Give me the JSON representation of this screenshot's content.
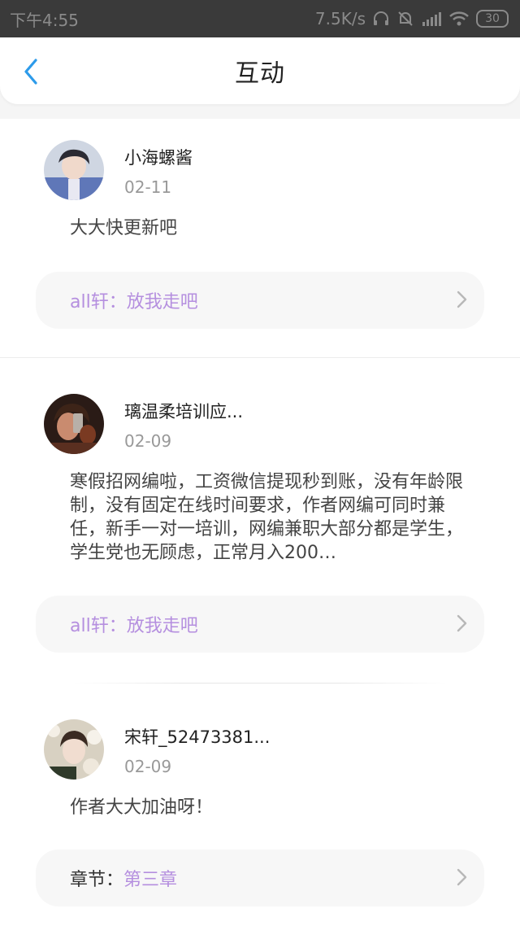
{
  "status_bar": {
    "time": "下午4:55",
    "net_speed": "7.5K/s",
    "battery": "30"
  },
  "header": {
    "title": "互动"
  },
  "items": [
    {
      "username": "小海螺酱",
      "date": "02-11",
      "comment": "大大快更新吧",
      "ref_prefix": "all轩：",
      "ref_target": "放我走吧"
    },
    {
      "username": "璃温柔培训应...",
      "date": "02-09",
      "comment": "寒假招网编啦，工资微信提现秒到账，没有年龄限制，没有固定在线时间要求，作者网编可同时兼任，新手一对一培训，网编兼职大部分都是学生，学生党也无顾虑，正常月入200…",
      "ref_prefix": "all轩：",
      "ref_target": "放我走吧"
    },
    {
      "username": "宋轩_52473381...",
      "date": "02-09",
      "comment": "作者大大加油呀！",
      "ref_prefix": "章节：",
      "ref_target": "第三章"
    }
  ],
  "colors": {
    "accent_purple": "#b58fdf",
    "back_blue": "#2d9bea",
    "status_bar_bg": "#3a3a3a"
  }
}
